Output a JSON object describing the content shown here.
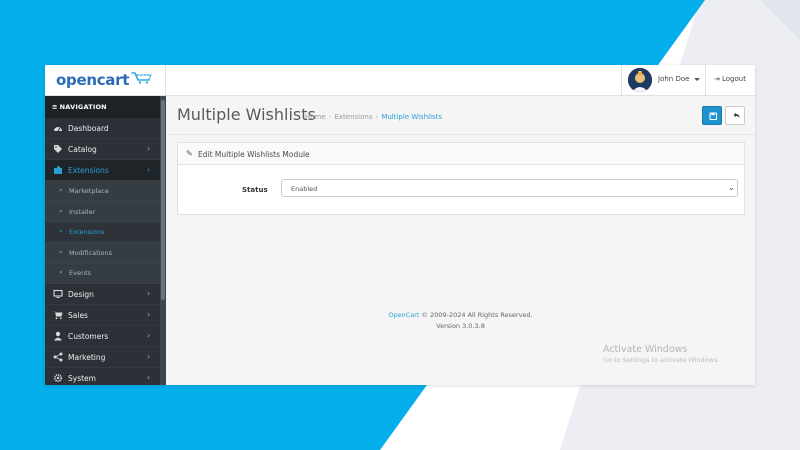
{
  "brand": {
    "logo_text": "opencart",
    "logo_color": "#2d6bb5",
    "accent": "#2a9fd6",
    "primary_button": "#1e91cf"
  },
  "header": {
    "user_name": "John Doe",
    "logout_label": "Logout"
  },
  "sidebar": {
    "heading": "NAVIGATION",
    "items": [
      {
        "label": "Dashboard",
        "icon": "dashboard-icon",
        "has_children": false
      },
      {
        "label": "Catalog",
        "icon": "tags-icon",
        "has_children": true
      },
      {
        "label": "Extensions",
        "icon": "puzzle-icon",
        "has_children": true,
        "active": true
      },
      {
        "label": "Design",
        "icon": "monitor-icon",
        "has_children": true
      },
      {
        "label": "Sales",
        "icon": "cart-icon",
        "has_children": true
      },
      {
        "label": "Customers",
        "icon": "user-icon",
        "has_children": true
      },
      {
        "label": "Marketing",
        "icon": "share-icon",
        "has_children": true
      },
      {
        "label": "System",
        "icon": "gear-icon",
        "has_children": true
      }
    ],
    "extensions_sub": [
      {
        "label": "Marketplace"
      },
      {
        "label": "Installer"
      },
      {
        "label": "Extensions",
        "selected": true
      },
      {
        "label": "Modifications"
      },
      {
        "label": "Events"
      }
    ]
  },
  "page": {
    "title": "Multiple Wishlists",
    "breadcrumb": [
      "Home",
      "Extensions",
      "Multiple Wishlists"
    ]
  },
  "panel": {
    "heading": "Edit Multiple Wishlists Module",
    "status_label": "Status",
    "status_value": "Enabled"
  },
  "footer": {
    "link_text": "OpenCart",
    "copyright": "© 2009-2024 All Rights Reserved.",
    "version": "Version 3.0.3.8"
  },
  "watermark": {
    "line1": "Activate Windows",
    "line2": "Go to Settings to activate Windows."
  }
}
